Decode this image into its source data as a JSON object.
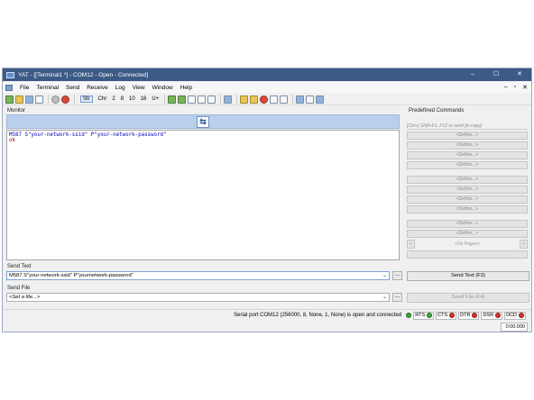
{
  "window": {
    "title": "YAT - [[Terminal1 *] - COM12 - Open - Connected]",
    "controls": [
      "–",
      "☐",
      "✕"
    ]
  },
  "menu": {
    "items": [
      "File",
      "Terminal",
      "Send",
      "Receive",
      "Log",
      "View",
      "Window",
      "Help"
    ],
    "mdi_controls": [
      "–",
      "▫",
      "✕"
    ]
  },
  "toolbar": {
    "radix": [
      "Str",
      "Chr",
      "2",
      "8",
      "10",
      "16",
      "U+"
    ]
  },
  "monitor": {
    "label": "Monitor",
    "swap_glyph": "⇆",
    "lines": [
      "M587 S\"your-network-ssid\" P\"your-network-password\"",
      "ok"
    ]
  },
  "predefined": {
    "label": "Predefined Commands",
    "hint": "[Ctrl+] Shift+F1..F12 to send [to copy]",
    "button_label": "<Define...>",
    "pager_prev": "<",
    "pager_next": ">",
    "pager_text": "<No Pages>"
  },
  "send_text": {
    "label": "Send Text",
    "value": "M587 S\"your-network-ssid\" P\"yournetwork-password\"",
    "button": "Send Text (F3)"
  },
  "send_file": {
    "label": "Send File",
    "value": "<Set a file...>",
    "button": "Send File (F4)"
  },
  "browse_label": "...",
  "status": {
    "text": "Serial port COM12 (256000, 8, None, 1, None) is open and connected",
    "signals": [
      {
        "name": "RTS",
        "state": "on"
      },
      {
        "name": "CTS",
        "state": "off"
      },
      {
        "name": "DTR",
        "state": "off"
      },
      {
        "name": "DSR",
        "state": "off"
      },
      {
        "name": "DCD",
        "state": "off"
      }
    ],
    "timer": "0:00.000"
  },
  "colors": {
    "titlebar": "#3c5a86",
    "monitor_header": "#b9d0ec",
    "tx_text": "#0000b4",
    "rx_text": "#b00000",
    "led_on": "#3aa93a",
    "led_off": "#d1362a"
  }
}
